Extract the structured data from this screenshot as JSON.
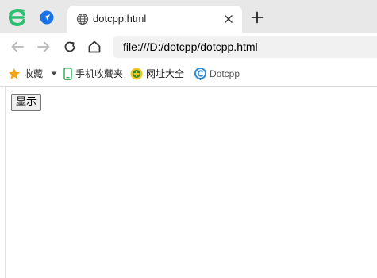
{
  "tab": {
    "title": "dotcpp.html",
    "icon": "globe-icon"
  },
  "address_bar": {
    "url": "file:///D:/dotcpp/dotcpp.html"
  },
  "bookmarks": {
    "favorites_label": "收藏",
    "mobile_favorites_label": "手机收藏夹",
    "web_nav_label": "网址大全",
    "dotcpp_label": "Dotcpp"
  },
  "page": {
    "show_button_label": "显示"
  },
  "icons": {
    "browser_logo": "browser-logo-icon",
    "pinned_tab": "navigation-arrow-icon",
    "close_tab": "close-icon",
    "new_tab": "plus-icon",
    "back": "arrow-left-icon",
    "forward": "arrow-right-icon",
    "reload": "reload-icon",
    "home": "home-icon",
    "favorites": "star-icon",
    "dropdown": "caret-down-icon",
    "mobile": "phone-icon",
    "web_nav": "web-nav-icon",
    "dotcpp": "dotcpp-icon"
  },
  "colors": {
    "logo_green": "#2fbf71",
    "pinned_blue": "#1a73e8",
    "star_orange": "#f5a21b",
    "phone_green": "#2ea84f",
    "nav_yellow": "#f3c623",
    "dotcpp_blue": "#2a8ad4"
  }
}
